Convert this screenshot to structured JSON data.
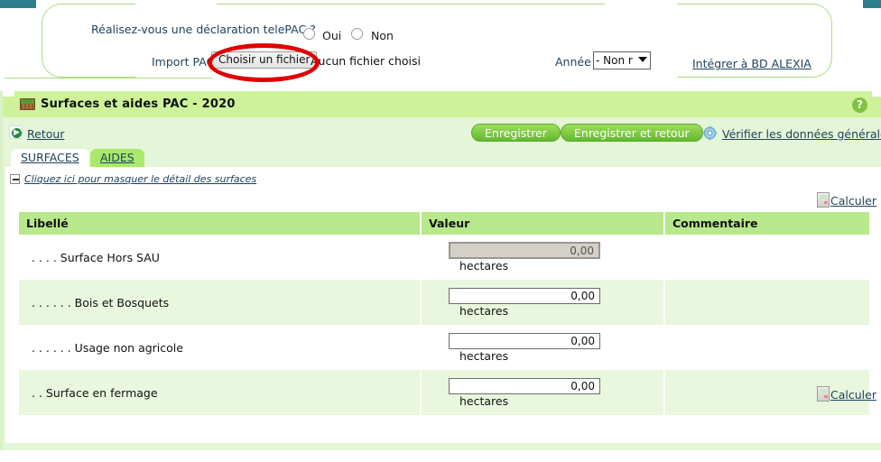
{
  "import_panel": {
    "telepac_question": "Réalisez-vous une déclaration telePAC ?",
    "radio_oui_label": "Oui",
    "radio_non_label": "Non",
    "import_label": "Import PAC",
    "file_button_label": "Choisir un fichier",
    "file_status": "Aucun fichier choisi",
    "annee_label": "Année",
    "annee_value": "- Non r",
    "alexia_link": "Intégrer à BD ALEXIA",
    "annotation": "red-ellipse-around-file-button"
  },
  "card": {
    "title": "Surfaces et aides PAC - 2020",
    "title_icon": "field-land-icon",
    "help_icon": "?",
    "toolbar": {
      "back_label": "Retour",
      "back_icon": "back-arrow-icon",
      "save_label": "Enregistrer",
      "save_return_label": "Enregistrer et retour",
      "gear_icon": "gear-icon",
      "verify_label": "Vérifier les données générales"
    },
    "tabs": [
      {
        "label": "SURFACES",
        "active": true
      },
      {
        "label": "AIDES",
        "active": false
      }
    ],
    "toggle_detail_link": "Cliquez ici pour masquer le détail des surfaces",
    "calculer_label": "Calculer",
    "calculer_icon": "calculator-icon",
    "table": {
      "headers": [
        "Libellé",
        "Valeur",
        "Commentaire"
      ],
      "rows": [
        {
          "label": ". . . . Surface Hors SAU",
          "value": "0,00",
          "unit": "hectares",
          "comment": "",
          "disabled": true,
          "alt": false
        },
        {
          "label": ". . . . . . Bois et Bosquets",
          "value": "0,00",
          "unit": "hectares",
          "comment": "",
          "disabled": false,
          "alt": true
        },
        {
          "label": ". . . . . . Usage non agricole",
          "value": "0,00",
          "unit": "hectares",
          "comment": "",
          "disabled": false,
          "alt": false
        },
        {
          "label": ". . Surface en fermage",
          "value": "0,00",
          "unit": "hectares",
          "comment": "",
          "disabled": false,
          "alt": true
        }
      ]
    }
  },
  "colors": {
    "teal_bar": "#2e7f8e",
    "header_green": "#cdf29a",
    "card_green": "#e4f5d8",
    "table_header_green": "#b8e88c",
    "row_alt_green": "#e8f7dd",
    "tab_inactive_green": "#a9e86a",
    "link_blue": "#20435c",
    "annotation_red": "#e00000",
    "pill_green": "#63b830"
  }
}
